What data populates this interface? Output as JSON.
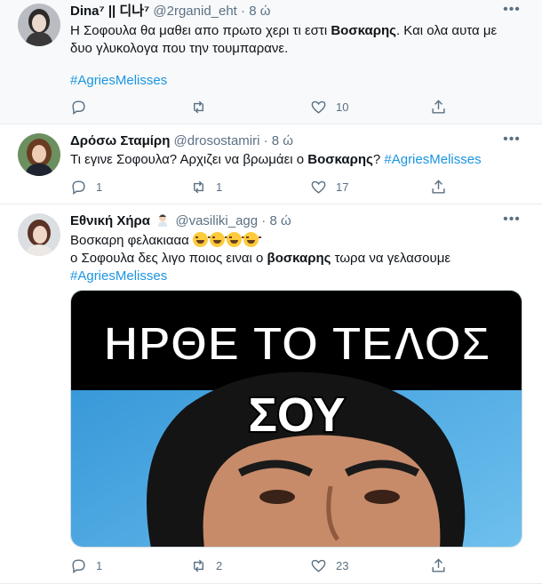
{
  "tweets": [
    {
      "name": "Dina⁷ || 디나⁷",
      "handle": "@2rganid_eht",
      "dot": "·",
      "time": "8 ώ",
      "body_pre": "Η Σοφουλα θα μαθει απο πρωτο χερι τι εστι ",
      "body_bold": "Βοσκαρης",
      "body_post": ". Και ολα αυτα με δυο γλυκολογα που την τουμπαρανε.",
      "hashtag": "#AgriesMelisses",
      "replies": "",
      "retweets": "",
      "likes": "10"
    },
    {
      "name": "Δρόσω Σταμίρη",
      "handle": "@drosostamiri",
      "dot": "·",
      "time": "8 ώ",
      "body_pre": "Τι εγινε Σοφουλα? Αρχιζει να βρωμάει ο ",
      "body_bold": "Βοσκαρης",
      "body_post": "? ",
      "hashtag": "#AgriesMelisses",
      "replies": "1",
      "retweets": "1",
      "likes": "17"
    },
    {
      "name": "Εθνική Χήρα",
      "handle": "@vasiliki_agg",
      "dot": "·",
      "time": "8 ώ",
      "line1": "Βοσκαρη φελακιααα",
      "line2_pre": "ο Σοφουλα δες λιγο ποιος ειναι ο ",
      "line2_bold": "βοσκαρης",
      "line2_post": " τωρα να γελασουμε",
      "hashtag": "#AgriesMelisses",
      "meme_line1": "ΗΡΘΕ ΤΟ ΤΕΛΟΣ",
      "meme_line2": "ΣΟΥ",
      "replies": "1",
      "retweets": "2",
      "likes": "23"
    }
  ],
  "icons": {
    "reply": "reply-icon",
    "retweet": "retweet-icon",
    "like": "heart-icon",
    "share": "share-icon",
    "more": "more-icon"
  },
  "colors": {
    "accent": "#1b95e0",
    "muted": "#5b7083",
    "highlight_bg": "#f7f9fa"
  }
}
